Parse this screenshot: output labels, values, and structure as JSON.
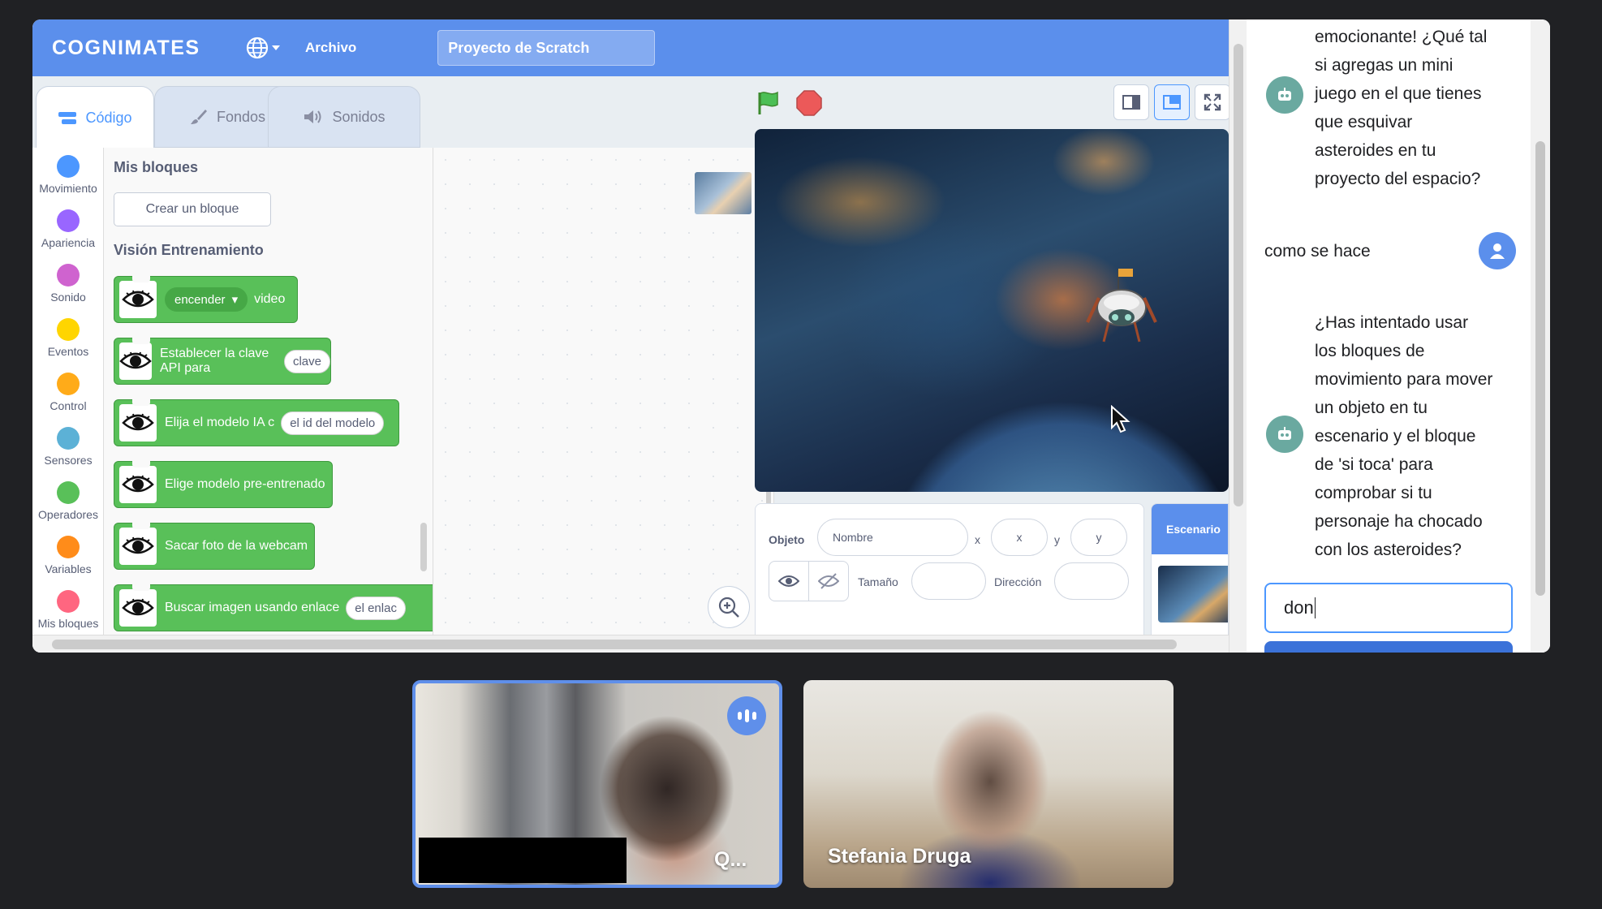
{
  "app": {
    "logo": "COGNIMATES",
    "menu_file": "Archivo",
    "project_title": "Proyecto de Scratch"
  },
  "tabs": [
    {
      "label": "Código",
      "icon": "code-icon",
      "active": true
    },
    {
      "label": "Fondos",
      "icon": "brush-icon",
      "active": false
    },
    {
      "label": "Sonidos",
      "icon": "speaker-icon",
      "active": false
    }
  ],
  "categories": [
    {
      "label": "Movimiento",
      "color": "#4c97ff"
    },
    {
      "label": "Apariencia",
      "color": "#9966ff"
    },
    {
      "label": "Sonido",
      "color": "#cf63cf"
    },
    {
      "label": "Eventos",
      "color": "#ffd500"
    },
    {
      "label": "Control",
      "color": "#ffab19"
    },
    {
      "label": "Sensores",
      "color": "#5cb1d6"
    },
    {
      "label": "Operadores",
      "color": "#59c059"
    },
    {
      "label": "Variables",
      "color": "#ff8c1a"
    },
    {
      "label": "Mis bloques",
      "color": "#ff6680"
    }
  ],
  "palette": {
    "my_blocks_heading": "Mis bloques",
    "make_block": "Crear un bloque",
    "extension_heading": "Visión Entrenamiento",
    "blocks": [
      {
        "dropdown": "encender",
        "text": "video"
      },
      {
        "text": "Establecer la clave API para",
        "input": "clave"
      },
      {
        "text": "Elija el modelo IA c",
        "input": "el id del modelo"
      },
      {
        "text": "Elige modelo pre-entrenado"
      },
      {
        "text": "Sacar foto de la webcam"
      },
      {
        "text": "Buscar imagen usando enlace",
        "input": "el enlac"
      }
    ]
  },
  "sprite_info": {
    "sprite_label": "Objeto",
    "name_placeholder": "Nombre",
    "x_label": "x",
    "x_placeholder": "x",
    "y_label": "y",
    "y_placeholder": "y",
    "size_label": "Tamaño",
    "direction_label": "Dirección"
  },
  "backdrop": {
    "label": "Escenario"
  },
  "chat": {
    "messages": [
      {
        "from": "bot",
        "lines": [
          "emocionante! ¿Qué tal",
          "si agregas un mini",
          "juego en el que tienes",
          "que esquivar",
          "asteroides en tu",
          "proyecto del espacio?"
        ]
      },
      {
        "from": "user",
        "lines": [
          "como se hace"
        ]
      },
      {
        "from": "bot",
        "lines": [
          "¿Has intentado usar",
          "los bloques de",
          "movimiento para mover",
          "un objeto en tu",
          "escenario y el bloque",
          "de 'si toca' para",
          "comprobar si tu",
          "personaje ha chocado",
          "con los asteroides?"
        ]
      }
    ],
    "input_value": "don"
  },
  "participants": [
    {
      "name": "Q...",
      "speaking": true
    },
    {
      "name": "Stefania Druga",
      "speaking": false
    }
  ],
  "colors": {
    "menubar": "#5b8fec",
    "extension_green": "#59c059",
    "accent": "#4c97ff",
    "bot_avatar": "#6aa9a0"
  }
}
